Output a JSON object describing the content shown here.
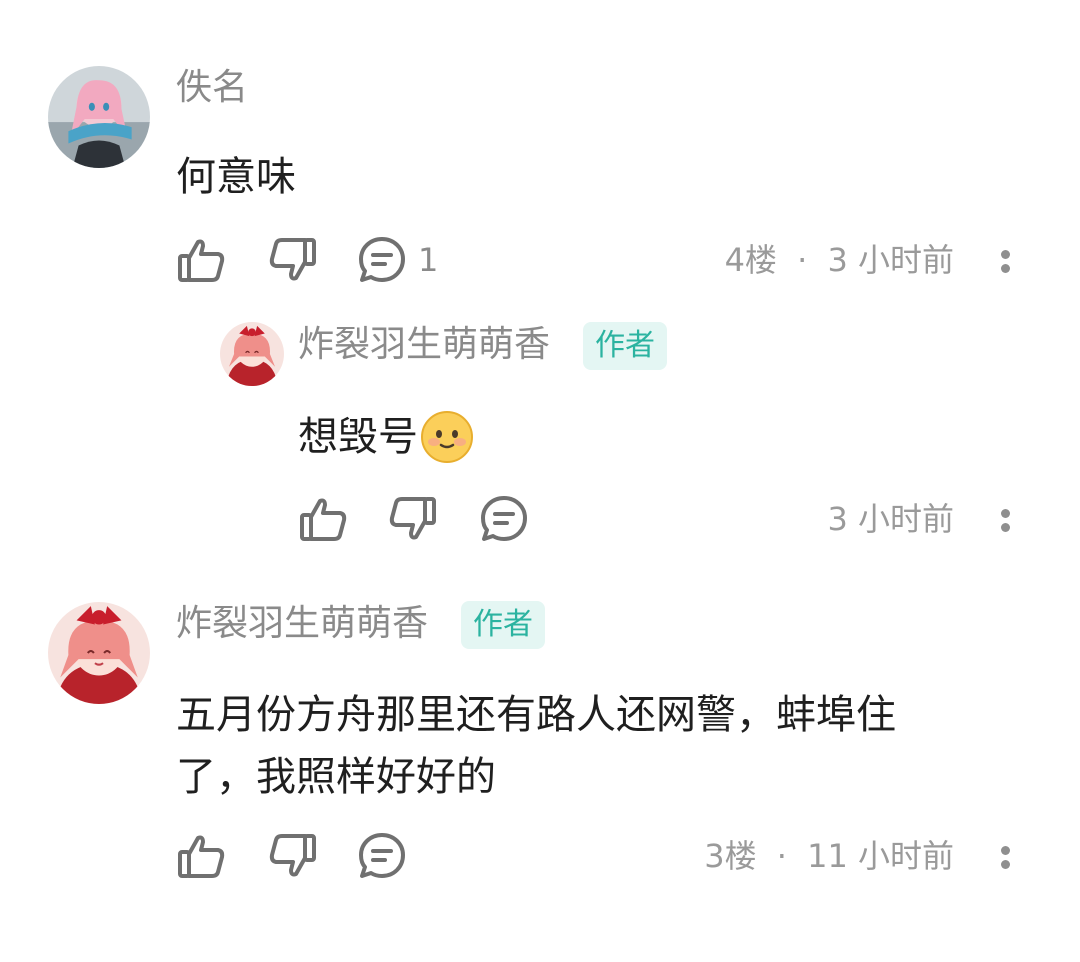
{
  "comments": [
    {
      "username": "佚名",
      "text": "何意味",
      "reply_count": "1",
      "floor": "4楼",
      "time": "3 小时前",
      "reply": {
        "username": "炸裂羽生萌萌香",
        "badge": "作者",
        "text": "想毁号",
        "emoji": "slightly-smiling-face",
        "time": "3 小时前"
      }
    },
    {
      "username": "炸裂羽生萌萌香",
      "badge": "作者",
      "text_line1": "五月份方舟那里还有路人还网警，蚌埠住",
      "text_line2": "了，我照样好好的",
      "floor": "3楼",
      "time": "11 小时前"
    }
  ],
  "separator": "·",
  "icons": {
    "like": "thumbs-up-icon",
    "dislike": "thumbs-down-icon",
    "reply": "comment-bubble-icon",
    "more": "more-vertical-icon"
  },
  "colors": {
    "badge_text": "#2bb3a0",
    "badge_bg": "#e4f6f3",
    "meta_text": "#9a9a9a",
    "content_text": "#1f1f1f"
  }
}
